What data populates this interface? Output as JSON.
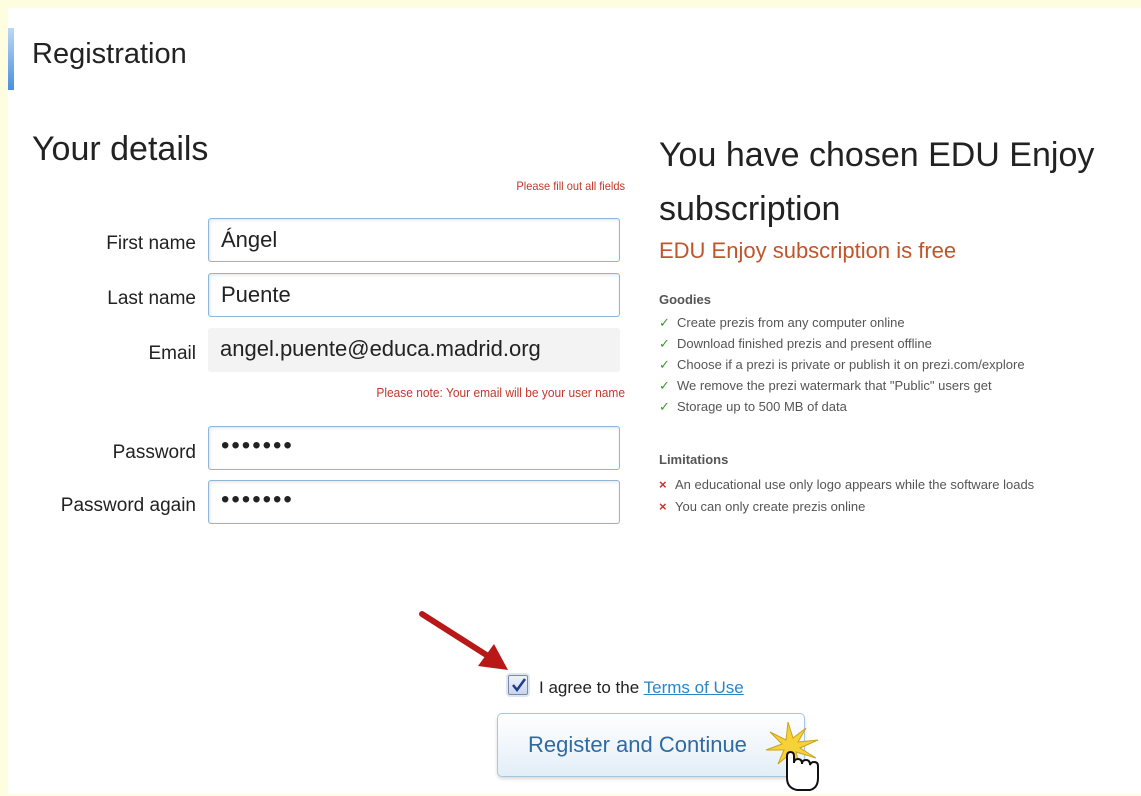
{
  "page": {
    "title": "Registration"
  },
  "details": {
    "heading": "Your details",
    "fill_note": "Please fill out all fields",
    "first_name": {
      "label": "First name",
      "value": "Ángel"
    },
    "last_name": {
      "label": "Last name",
      "value": "Puente"
    },
    "email": {
      "label": "Email",
      "value": "angel.puente@educa.madrid.org",
      "note": "Please note: Your email will be your user name"
    },
    "password": {
      "label": "Password",
      "value": "•••••••"
    },
    "password_again": {
      "label": "Password again",
      "value": "•••••••"
    }
  },
  "plan": {
    "heading": "You have chosen EDU Enjoy subscription",
    "price_note": "EDU Enjoy subscription is free",
    "goodies_heading": "Goodies",
    "goodies": [
      "Create prezis from any computer online",
      "Download finished prezis and present offline",
      "Choose if a prezi is private or publish it on prezi.com/explore",
      "We remove the prezi watermark that \"Public\" users get",
      "Storage up to 500 MB of data"
    ],
    "limitations_heading": "Limitations",
    "limitations": [
      "An educational use only logo appears while the software loads",
      "You can only create prezis online"
    ]
  },
  "agree": {
    "checked": true,
    "prefix": "I agree to the",
    "link": "Terms of Use"
  },
  "register_button": "Register and Continue",
  "colors": {
    "accent_red": "#c0392b",
    "link_blue": "#2a86c7",
    "check_green": "#3a9a2a",
    "button_text": "#2f6aa3"
  },
  "icons": [
    "check-icon",
    "cross-icon",
    "red-arrow-icon",
    "hand-cursor-icon",
    "checkbox-check-icon"
  ]
}
